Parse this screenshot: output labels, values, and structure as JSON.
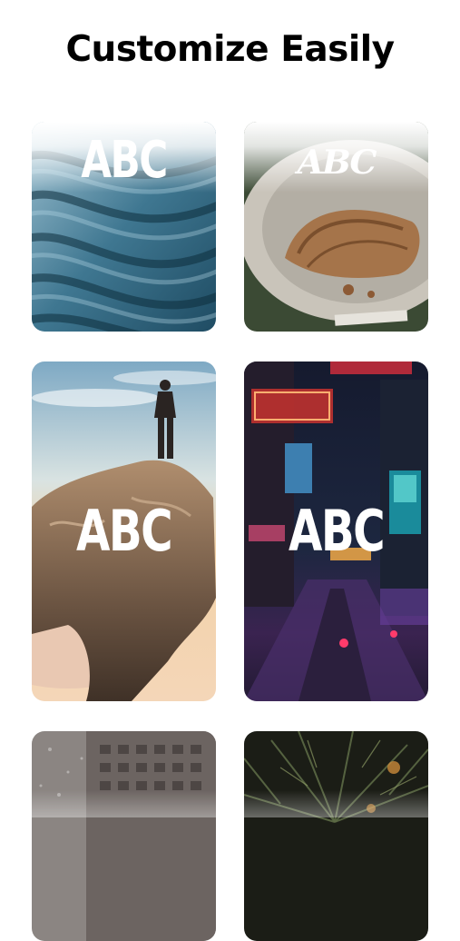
{
  "header": {
    "title": "Customize Easily"
  },
  "cards": [
    {
      "name": "Sand",
      "label": "ABC"
    },
    {
      "name": "Croissant",
      "label": "ABC"
    },
    {
      "name": "Mountain climber",
      "label": "ABC"
    },
    {
      "name": "Neon city",
      "label": "ABC"
    },
    {
      "name": "Rainy window",
      "label": ""
    },
    {
      "name": "Palm leaves",
      "label": ""
    }
  ]
}
